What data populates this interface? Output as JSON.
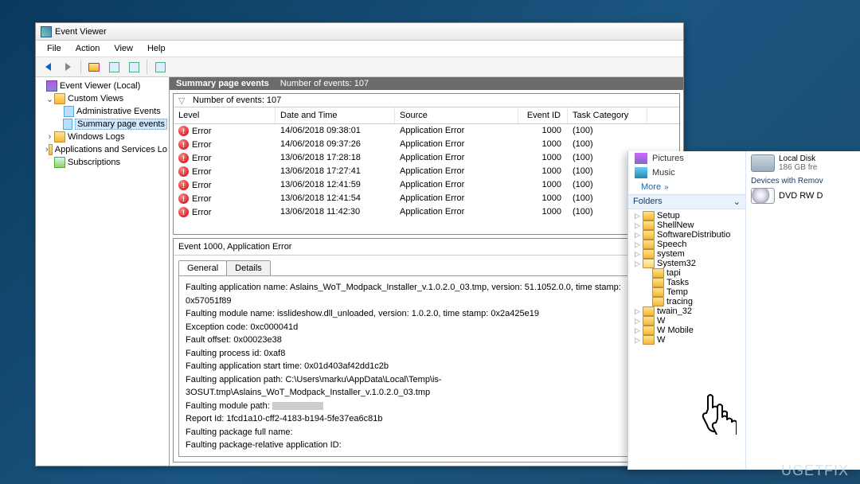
{
  "window": {
    "title": "Event Viewer"
  },
  "menu": {
    "file": "File",
    "action": "Action",
    "view": "View",
    "help": "Help"
  },
  "tree": {
    "root": "Event Viewer (Local)",
    "custom": "Custom Views",
    "admin": "Administrative Events",
    "summary": "Summary page events",
    "winlogs": "Windows Logs",
    "apps": "Applications and Services Lo",
    "subs": "Subscriptions"
  },
  "summary_bar": {
    "title": "Summary page events",
    "count_label": "Number of events: 107"
  },
  "filter_row": {
    "label": "Number of events: 107"
  },
  "columns": {
    "level": "Level",
    "date": "Date and Time",
    "source": "Source",
    "eid": "Event ID",
    "task": "Task Category"
  },
  "events": [
    {
      "level": "Error",
      "date": "14/06/2018 09:38:01",
      "source": "Application Error",
      "eid": "1000",
      "task": "(100)"
    },
    {
      "level": "Error",
      "date": "14/06/2018 09:37:26",
      "source": "Application Error",
      "eid": "1000",
      "task": "(100)"
    },
    {
      "level": "Error",
      "date": "13/06/2018 17:28:18",
      "source": "Application Error",
      "eid": "1000",
      "task": "(100)"
    },
    {
      "level": "Error",
      "date": "13/06/2018 17:27:41",
      "source": "Application Error",
      "eid": "1000",
      "task": "(100)"
    },
    {
      "level": "Error",
      "date": "13/06/2018 12:41:59",
      "source": "Application Error",
      "eid": "1000",
      "task": "(100)"
    },
    {
      "level": "Error",
      "date": "13/06/2018 12:41:54",
      "source": "Application Error",
      "eid": "1000",
      "task": "(100)"
    },
    {
      "level": "Error",
      "date": "13/06/2018 11:42:30",
      "source": "Application Error",
      "eid": "1000",
      "task": "(100)"
    }
  ],
  "detail": {
    "title": "Event 1000, Application Error",
    "tab_general": "General",
    "tab_details": "Details",
    "lines": [
      "Faulting application name: Aslains_WoT_Modpack_Installer_v.1.0.2.0_03.tmp, version: 51.1052.0.0, time stamp: 0x57051f89",
      "Faulting module name: isslideshow.dll_unloaded, version: 1.0.2.0, time stamp: 0x2a425e19",
      "Exception code: 0xc000041d",
      "Fault offset: 0x00023e38",
      "Faulting process id: 0xaf8",
      "Faulting application start time: 0x01d403af42dd1c2b",
      "Faulting application path: C:\\Users\\marku\\AppData\\Local\\Temp\\is-3OSUT.tmp\\Aslains_WoT_Modpack_Installer_v.1.0.2.0_03.tmp",
      "Faulting module path:",
      "Report Id: 1fcd1a10-cff2-4183-b194-5fe37ea6c81b",
      "Faulting package full name:",
      "Faulting package-relative application ID:"
    ]
  },
  "explorer": {
    "libs": {
      "pictures": "Pictures",
      "music": "Music"
    },
    "more": "More",
    "folders_hdr": "Folders",
    "tree": [
      "Setup",
      "ShellNew",
      "SoftwareDistributio",
      "Speech",
      "system",
      "System32",
      "tapi",
      "Tasks",
      "Temp",
      "tracing",
      "twain_32",
      "W",
      "W          Mobile",
      "W"
    ],
    "drive": {
      "name": "Local Disk",
      "free": "186 GB fre"
    },
    "section": "Devices with Remov",
    "dvd": "DVD RW D"
  },
  "watermark": "UGETFIX"
}
